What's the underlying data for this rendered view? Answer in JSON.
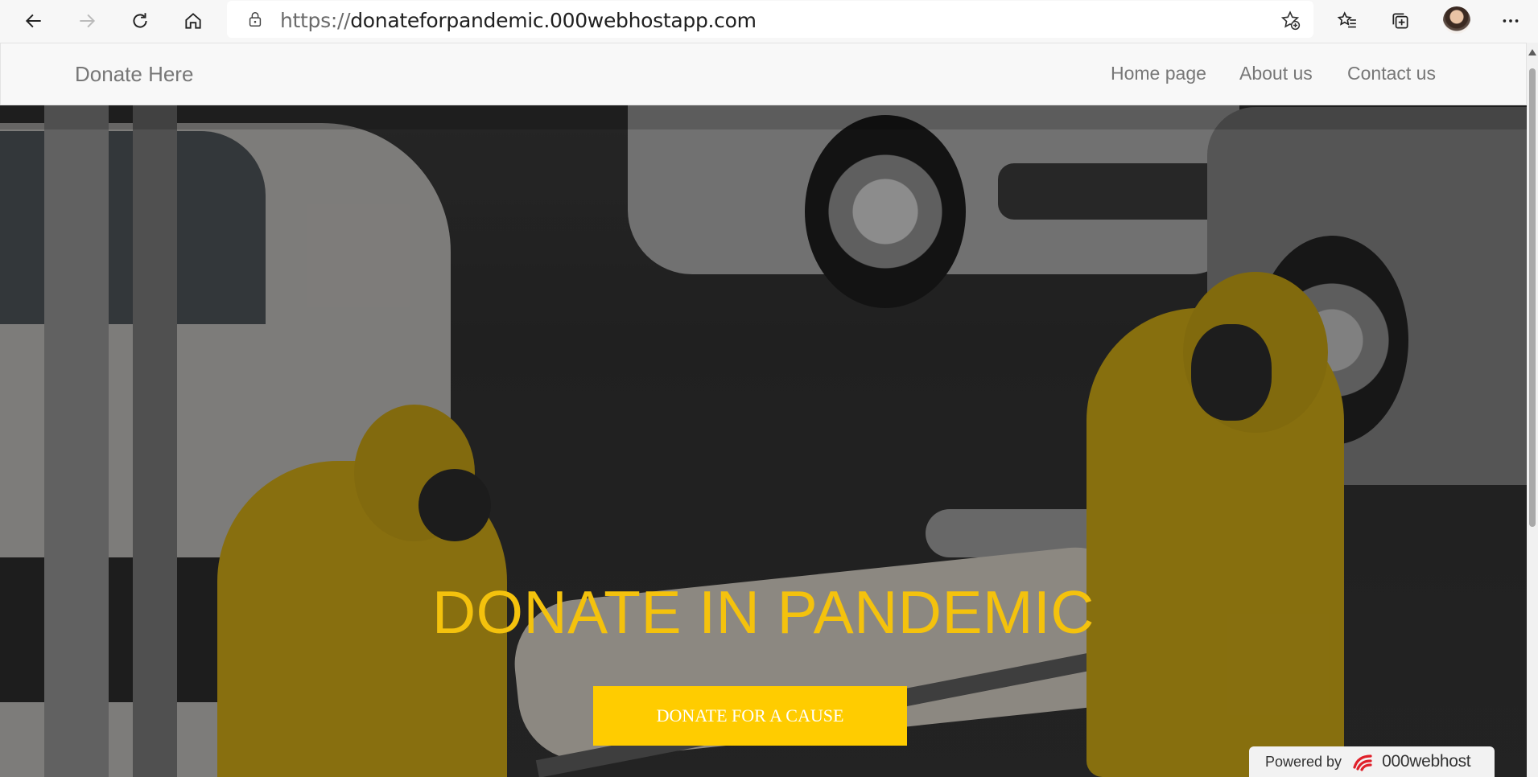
{
  "browser": {
    "url_protocol": "https://",
    "url_host": "donateforpandemic.000webhostapp.com"
  },
  "site": {
    "brand": "Donate Here",
    "nav": [
      {
        "label": "Home page"
      },
      {
        "label": "About us"
      },
      {
        "label": "Contact us"
      }
    ]
  },
  "hero": {
    "title": "DONATE IN PANDEMIC",
    "cta_label": "DONATE FOR A CAUSE",
    "title_color": "#f4c20d",
    "cta_color": "#ffcc00"
  },
  "badge": {
    "powered_by": "Powered by",
    "host_name": "000webhost"
  }
}
